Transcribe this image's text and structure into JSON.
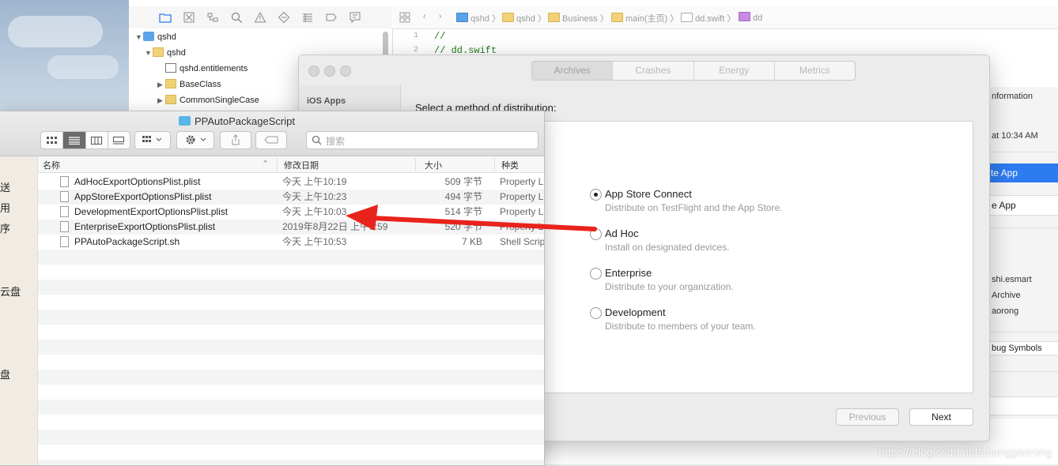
{
  "xcode": {
    "navigator": {
      "items": [
        {
          "label": "qshd",
          "icon": "project-icon",
          "expanded": true
        },
        {
          "label": "qshd",
          "icon": "folder-icon",
          "expanded": true
        },
        {
          "label": "qshd.entitlements",
          "icon": "entitlements-file-icon"
        },
        {
          "label": "BaseClass",
          "icon": "folder-icon",
          "expanded": false
        },
        {
          "label": "CommonSingleCase",
          "icon": "folder-icon",
          "expanded": false
        }
      ]
    },
    "jumpbar": {
      "crumbs": [
        "qshd",
        "qshd",
        "Business",
        "main(主页)",
        "dd.swift",
        "dd"
      ]
    },
    "editor": {
      "lines": [
        {
          "num": "1",
          "text": "//"
        },
        {
          "num": "2",
          "text": "//  dd.swift"
        }
      ]
    }
  },
  "organizer": {
    "tabs": [
      "Archives",
      "Crashes",
      "Energy",
      "Metrics"
    ],
    "selected_tab": "Archives",
    "sidebar_label": "iOS Apps",
    "sheet_title": "Select a method of distribution:",
    "options": [
      {
        "title": "App Store Connect",
        "desc": "Distribute on TestFlight and the App Store.",
        "selected": true
      },
      {
        "title": "Ad Hoc",
        "desc": "Install on designated devices.",
        "selected": false
      },
      {
        "title": "Enterprise",
        "desc": "Distribute to your organization.",
        "selected": false
      },
      {
        "title": "Development",
        "desc": "Distribute to members of your team.",
        "selected": false
      }
    ],
    "previous_label": "Previous",
    "next_label": "Next"
  },
  "inspector": {
    "information": "nformation",
    "time": "at 10:34 AM",
    "distribute": "te App",
    "validate": "e App",
    "team": "shi.esmart",
    "archive": "Archive",
    "user": "aorong",
    "debug": "bug Symbols"
  },
  "finder": {
    "title": "PPAutoPackageScript",
    "search_placeholder": "搜索",
    "sidebar": [
      "送",
      "用",
      "序",
      "云盘",
      "盘"
    ],
    "columns": {
      "name": "名称",
      "date": "修改日期",
      "size": "大小",
      "kind": "种类"
    },
    "files": [
      {
        "name": "AdHocExportOptionsPlist.plist",
        "date": "今天 上午10:19",
        "size": "509 字节",
        "kind": "Property L"
      },
      {
        "name": "AppStoreExportOptionsPlist.plist",
        "date": "今天 上午10:23",
        "size": "494 字节",
        "kind": "Property L"
      },
      {
        "name": "DevelopmentExportOptionsPlist.plist",
        "date": "今天 上午10:03",
        "size": "514 字节",
        "kind": "Property L"
      },
      {
        "name": "EnterpriseExportOptionsPlist.plist",
        "date": "2019年8月22日 上午8:59",
        "size": "520 字节",
        "kind": "Property L"
      },
      {
        "name": "PPAutoPackageScript.sh",
        "date": "今天 上午10:53",
        "size": "7 KB",
        "kind": "Shell Scrip"
      }
    ]
  },
  "colors": {
    "accent": "#2e7bf0",
    "arrow": "#e8231c",
    "folder": "#f0d278",
    "finder_folder": "#59b6e8"
  },
  "watermark": "https://blog.csdn.net/zhonggaorong"
}
